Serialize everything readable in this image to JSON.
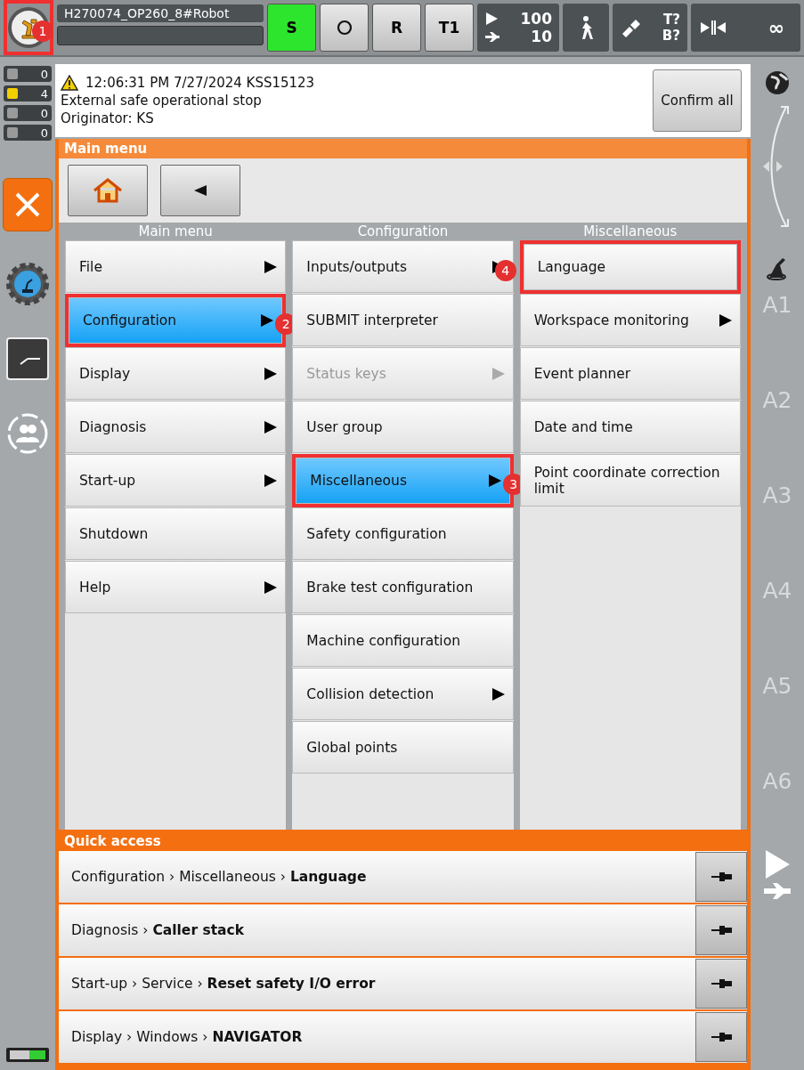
{
  "top_bar": {
    "robot_name": "H270074_OP260_8#Robot",
    "logo_callout": "1",
    "mode_buttons": [
      {
        "kind": "text",
        "label": "S",
        "active": true
      },
      {
        "kind": "circle",
        "active": false
      },
      {
        "kind": "text",
        "label": "R",
        "active": false
      },
      {
        "kind": "text",
        "label": "T1",
        "active": false
      }
    ],
    "override": {
      "program": "100",
      "jog": "10"
    },
    "tool_base": {
      "tool": "T?",
      "base": "B?"
    },
    "run_mode": "∞"
  },
  "message_counts": [
    {
      "kind": "error",
      "count": "0"
    },
    {
      "kind": "warning",
      "count": "4"
    },
    {
      "kind": "info",
      "count": "0"
    },
    {
      "kind": "wait",
      "count": "0"
    }
  ],
  "message": {
    "header": "12:06:31 PM 7/27/2024 KSS15123",
    "text": "External safe operational stop",
    "originator": "Originator: KS",
    "confirm_button": "Confirm all"
  },
  "main_menu": {
    "title": "Main menu",
    "columns": [
      {
        "header": "Main menu",
        "items": [
          {
            "label": "File",
            "submenu": true,
            "selected": false,
            "disabled": false
          },
          {
            "label": "Configuration",
            "submenu": true,
            "selected": true,
            "disabled": false,
            "callout": "2"
          },
          {
            "label": "Display",
            "submenu": true,
            "selected": false,
            "disabled": false
          },
          {
            "label": "Diagnosis",
            "submenu": true,
            "selected": false,
            "disabled": false
          },
          {
            "label": "Start-up",
            "submenu": true,
            "selected": false,
            "disabled": false
          },
          {
            "label": "Shutdown",
            "submenu": false,
            "selected": false,
            "disabled": false
          },
          {
            "label": "Help",
            "submenu": true,
            "selected": false,
            "disabled": false
          }
        ]
      },
      {
        "header": "Configuration",
        "items": [
          {
            "label": "Inputs/outputs",
            "submenu": true,
            "selected": false,
            "disabled": false
          },
          {
            "label": "SUBMIT interpreter",
            "submenu": false,
            "selected": false,
            "disabled": false
          },
          {
            "label": "Status keys",
            "submenu": true,
            "selected": false,
            "disabled": true
          },
          {
            "label": "User group",
            "submenu": false,
            "selected": false,
            "disabled": false
          },
          {
            "label": "Miscellaneous",
            "submenu": true,
            "selected": true,
            "disabled": false,
            "callout": "3"
          },
          {
            "label": "Safety configuration",
            "submenu": false,
            "selected": false,
            "disabled": false
          },
          {
            "label": "Brake test configuration",
            "submenu": false,
            "selected": false,
            "disabled": false
          },
          {
            "label": "Machine configuration",
            "submenu": false,
            "selected": false,
            "disabled": false
          },
          {
            "label": "Collision detection",
            "submenu": true,
            "selected": false,
            "disabled": false
          },
          {
            "label": "Global points",
            "submenu": false,
            "selected": false,
            "disabled": false
          }
        ]
      },
      {
        "header": "Miscellaneous",
        "items": [
          {
            "label": "Language",
            "submenu": false,
            "selected": false,
            "disabled": false,
            "callout": "4"
          },
          {
            "label": "Workspace monitoring",
            "submenu": true,
            "selected": false,
            "disabled": false
          },
          {
            "label": "Event planner",
            "submenu": false,
            "selected": false,
            "disabled": false
          },
          {
            "label": "Date and time",
            "submenu": false,
            "selected": false,
            "disabled": false
          },
          {
            "label": "Point coordinate correction limit",
            "submenu": false,
            "selected": false,
            "disabled": false
          }
        ]
      }
    ]
  },
  "quick_access": {
    "title": "Quick access",
    "items": [
      {
        "path": "Configuration › Miscellaneous › **Language**"
      },
      {
        "path": "Diagnosis › **Caller stack**"
      },
      {
        "path": "Start-up › Service › **Reset safety I/O error**"
      },
      {
        "path": "Display › Windows › **NAVIGATOR**"
      }
    ]
  },
  "jog_axes": [
    "A1",
    "A2",
    "A3",
    "A4",
    "A5",
    "A6"
  ]
}
